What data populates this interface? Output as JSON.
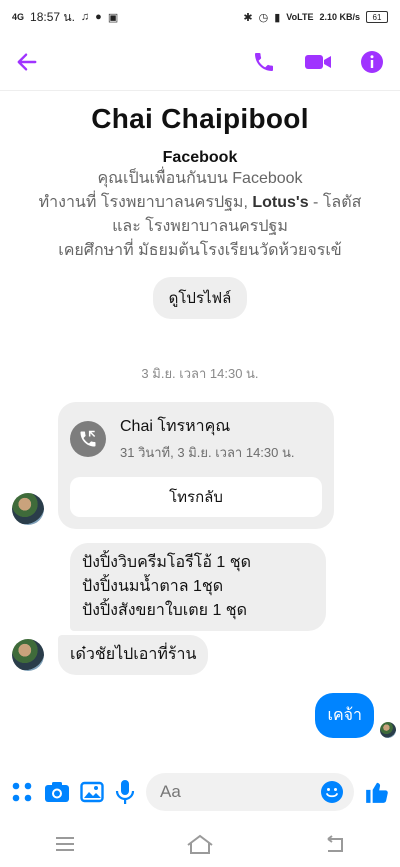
{
  "status": {
    "carrier": "4G",
    "time": "18:57 น.",
    "indicators": "VoLTE",
    "speed": "2.10 KB/s",
    "battery": "61"
  },
  "header": {
    "back_icon": "arrow-left-icon",
    "call_icon": "phone-icon",
    "video_icon": "video-camera-icon",
    "info_icon": "info-icon"
  },
  "profile": {
    "name": "Chai Chaipibool",
    "source": "Facebook",
    "friends": "คุณเป็นเพื่อนกันบน Facebook",
    "work_prefix": "ทำงานที่ โรงพยาบาลนครปฐม, ",
    "work_bold": "Lotus's",
    "work_suffix": " - โลตัส",
    "work_line2": "และ โรงพยาบาลนครปฐม",
    "education": "เคยศึกษาที่ มัธยมต้นโรงเรียนวัดห้วยจรเข้",
    "view_profile": "ดูโปรไฟล์"
  },
  "conversation": {
    "timestamp": "3 มิ.ย. เวลา 14:30 น.",
    "call": {
      "title": "Chai โทรหาคุณ",
      "detail": "31 วินาที, 3 มิ.ย. เวลา 14:30 น.",
      "callback": "โทรกลับ"
    },
    "their_message_1": [
      "ปังปิ้งวิบครีมโอรีโอ้ 1 ชุด",
      "ปังปิ้งนมน้ำตาล 1ชุด",
      "ปังปิ้งสังขยาใบเตย 1 ชุด"
    ],
    "their_message_2": "เด๋วชัยไปเอาที่ร้าน",
    "my_message": "เคจ้า"
  },
  "composer": {
    "placeholder": "Aa"
  },
  "colors": {
    "accent": "#a033ff",
    "blue": "#0084ff",
    "bubble": "#eeeeee"
  }
}
